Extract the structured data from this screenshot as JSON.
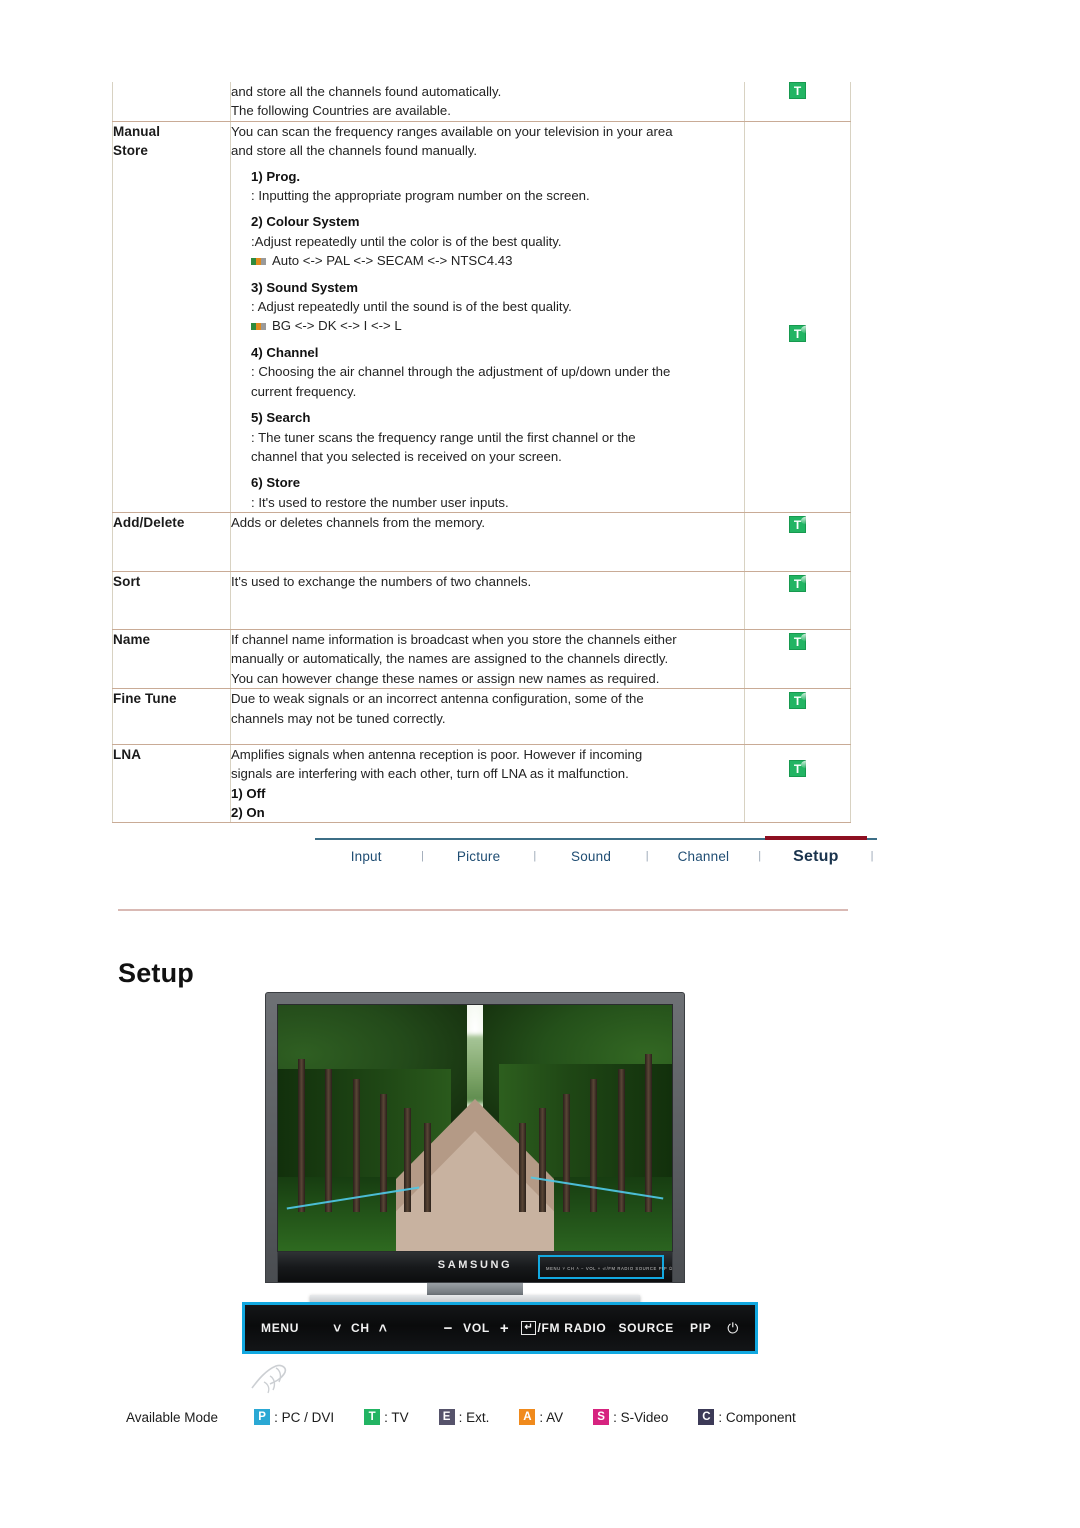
{
  "table": {
    "rows": [
      {
        "label": "",
        "desc_lines": [
          "and store all the channels found automatically.",
          "The following Countries are available."
        ],
        "icons": [
          "t-badge-only"
        ]
      },
      {
        "label": "Manual\nStore",
        "label_line1": "Manual",
        "label_line2": "Store",
        "desc_lines": [
          "You can scan the frequency ranges available on your television in your area",
          "and store all the channels found manually."
        ],
        "sub_items": [
          {
            "head": "1) Prog.",
            "body": [
              ": Inputting the appropriate program number on the screen."
            ]
          },
          {
            "head": "2) Colour System",
            "body": [
              ":Adjust repeatedly until the color is of the best quality."
            ],
            "bullet": "Auto <-> PAL <-> SECAM <-> NTSC4.43"
          },
          {
            "head": "3) Sound System",
            "body": [
              ": Adjust repeatedly until the sound is of the best quality."
            ],
            "bullet": "BG <-> DK <-> I <-> L"
          },
          {
            "head": "4) Channel",
            "body": [
              ": Choosing the air channel through the adjustment of up/down under the",
              "current frequency."
            ]
          },
          {
            "head": "5) Search",
            "body": [
              ": The tuner scans the frequency range until the first channel or the",
              "channel that you selected is received on your screen."
            ]
          },
          {
            "head": "6) Store",
            "body": [
              ": It's used to restore the number user inputs."
            ]
          }
        ],
        "icons": [
          "orb",
          "t"
        ]
      },
      {
        "label": "Add/Delete",
        "desc_lines": [
          "Adds or deletes channels from the memory."
        ],
        "icons": [
          "orb",
          "t"
        ]
      },
      {
        "label": "Sort",
        "desc_lines": [
          "It's used to exchange the numbers of two channels."
        ],
        "icons": [
          "orb",
          "t"
        ]
      },
      {
        "label": "Name",
        "desc_lines": [
          "If channel name information is broadcast when you store the channels either",
          "manually or automatically, the names are assigned to the channels directly.",
          "You can however change these names or assign new names as required."
        ],
        "icons": [
          "orb",
          "t"
        ]
      },
      {
        "label": "Fine Tune",
        "desc_lines": [
          "Due to weak signals or an incorrect antenna configuration, some of the",
          "channels may not be tuned correctly."
        ],
        "icons": [
          "orb",
          "t"
        ]
      },
      {
        "label": "LNA",
        "desc_lines": [
          "Amplifies signals when antenna reception is poor. However if incoming",
          "signals are interfering with each other, turn off LNA as it malfunction."
        ],
        "options": [
          "1) Off",
          "2) On"
        ],
        "icons": [
          "orb",
          "t"
        ]
      }
    ]
  },
  "nav": {
    "items": [
      {
        "label": "Input",
        "active": false
      },
      {
        "label": "Picture",
        "active": false
      },
      {
        "label": "Sound",
        "active": false
      },
      {
        "label": "Channel",
        "active": false
      },
      {
        "label": "Setup",
        "active": true
      }
    ],
    "separator": "|",
    "active_color": "#8d0f21",
    "link_color": "#1f4d73"
  },
  "section": {
    "heading": "Setup"
  },
  "monitor": {
    "brand": "SAMSUNG",
    "highlight_color": "#12a8e0"
  },
  "control_panel": {
    "menu": "MENU",
    "ch_down": "˅",
    "ch": "CH",
    "ch_up": "˄",
    "vol_minus": "−",
    "vol": "VOL",
    "vol_plus": "+",
    "enter_key": "↵",
    "fm_radio": "/FM RADIO",
    "source": "SOURCE",
    "pip": "PIP",
    "power": "⏻"
  },
  "legend": {
    "title": "Available Mode",
    "items": [
      {
        "badge": "P",
        "text": ": PC / DVI",
        "color": "#2aa8d4"
      },
      {
        "badge": "T",
        "text": ": TV",
        "color": "#22b463"
      },
      {
        "badge": "E",
        "text": ": Ext.",
        "color": "#56536b"
      },
      {
        "badge": "A",
        "text": ": AV",
        "color": "#f08a1c"
      },
      {
        "badge": "S",
        "text": ": S-Video",
        "color": "#d6237f"
      },
      {
        "badge": "C",
        "text": ": Component",
        "color": "#3c3a57"
      }
    ]
  }
}
